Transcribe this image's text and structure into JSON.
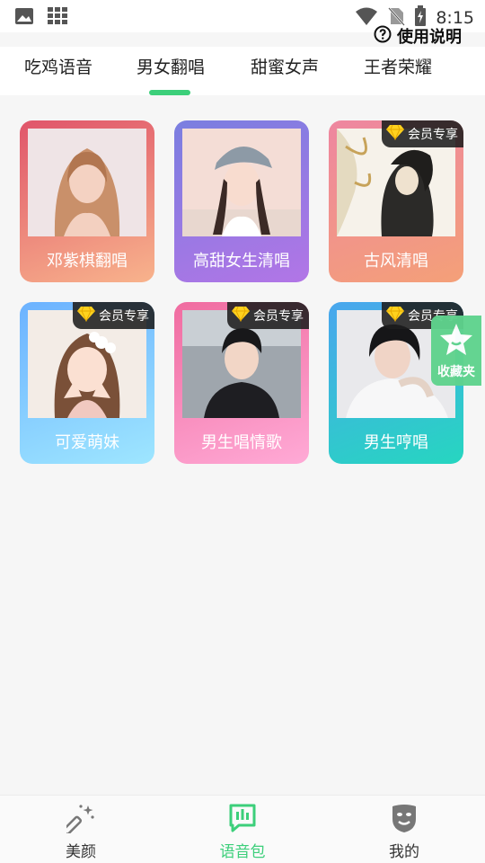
{
  "status_bar": {
    "time": "8:15",
    "left_icons": [
      "image-icon",
      "grid-apps-icon"
    ],
    "right_icons": [
      "wifi-icon",
      "no-sim-icon",
      "battery-charging-icon"
    ]
  },
  "header": {
    "help_label": "使用说明",
    "help_icon": "question-circle-icon"
  },
  "tabs": [
    {
      "label": "吃鸡语音",
      "active": false
    },
    {
      "label": "男女翻唱",
      "active": true
    },
    {
      "label": "甜蜜女声",
      "active": false
    },
    {
      "label": "王者荣耀",
      "active": false
    }
  ],
  "accent_color": "#3ccf7a",
  "cards": [
    {
      "label": "邓紫棋翻唱",
      "vip": false,
      "gradient": [
        "#e0556a",
        "#f8b38c"
      ]
    },
    {
      "label": "高甜女生清唱",
      "vip": false,
      "gradient": [
        "#7a7ee0",
        "#b275e6"
      ]
    },
    {
      "label": "古风清唱",
      "vip": true,
      "vip_label": "会员专享",
      "gradient": [
        "#ee86a0",
        "#f4a078"
      ]
    },
    {
      "label": "可爱萌妹",
      "vip": true,
      "vip_label": "会员专享",
      "gradient": [
        "#6cb2ff",
        "#9ee6ff"
      ]
    },
    {
      "label": "男生唱情歌",
      "vip": true,
      "vip_label": "会员专享",
      "gradient": [
        "#f06ca0",
        "#ffaad6"
      ]
    },
    {
      "label": "男生哼唱",
      "vip": true,
      "vip_label": "会员专享",
      "gradient": [
        "#4aa6ee",
        "#26d6c0"
      ]
    }
  ],
  "favorites": {
    "label": "收藏夹",
    "icon": "star-icon"
  },
  "bottom_nav": [
    {
      "label": "美颜",
      "icon": "magic-wand-icon",
      "active": false
    },
    {
      "label": "语音包",
      "icon": "voice-message-icon",
      "active": true
    },
    {
      "label": "我的",
      "icon": "mask-face-icon",
      "active": false
    }
  ]
}
